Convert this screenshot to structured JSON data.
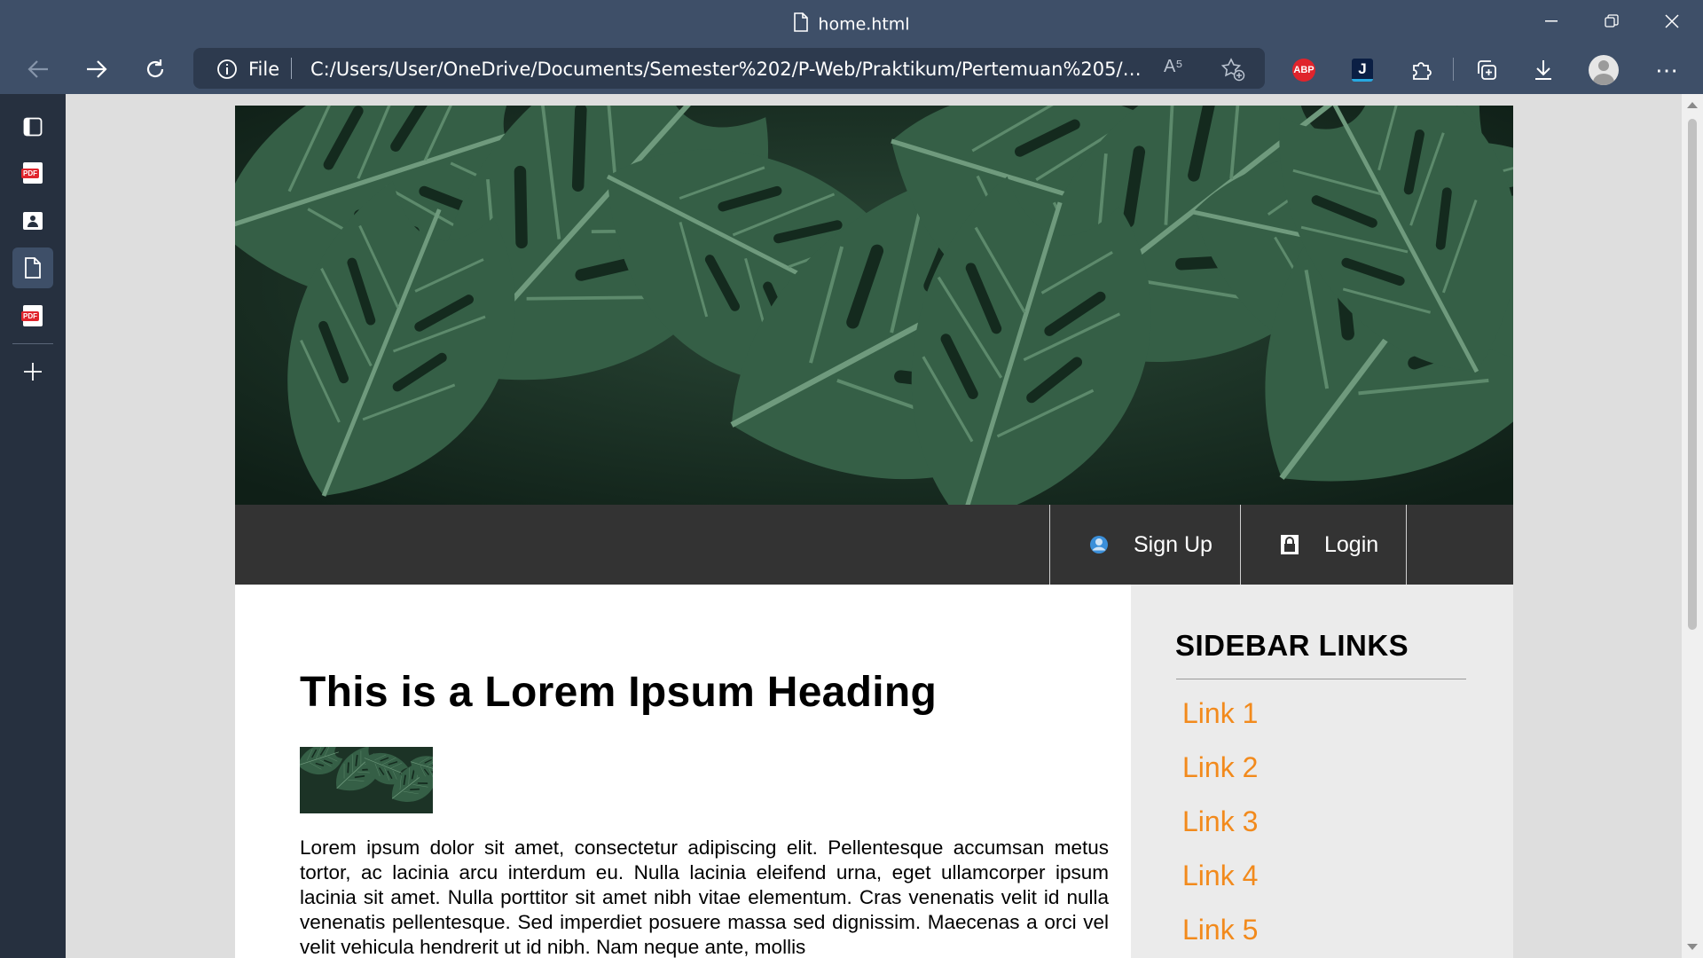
{
  "browser": {
    "tab_title": "home.html",
    "address": {
      "scheme_label": "File",
      "url": "C:/Users/User/OneDrive/Documents/Semester%202/P-Web/Praktikum/Pertemuan%205/Post/home.ht...",
      "read_aloud_label": "A⁵"
    },
    "extensions": {
      "adblock_label": "ABP",
      "j_label": "J"
    },
    "more_label": "⋯",
    "vertical_tabs": [
      "tab-actions",
      "pdf-document",
      "contact-card",
      "home.html",
      "pdf-document",
      "new-tab"
    ]
  },
  "page": {
    "nav": {
      "signup_label": "Sign Up",
      "login_label": "Login"
    },
    "main": {
      "heading": "This is a Lorem Ipsum Heading",
      "paragraph": "Lorem ipsum dolor sit amet, consectetur adipiscing elit. Pellentesque accumsan metus tortor, ac lacinia arcu interdum eu. Nulla lacinia eleifend urna, eget ullamcorper ipsum lacinia sit amet. Nulla porttitor sit amet nibh vitae elementum. Cras venenatis velit id nulla venenatis pellentesque. Sed imperdiet posuere massa sed dignissim. Maecenas a orci vel velit vehicula hendrerit ut id nibh. Nam neque ante, mollis"
    },
    "sidebar": {
      "title": "SIDEBAR LINKS",
      "links": [
        "Link 1",
        "Link 2",
        "Link 3",
        "Link 4",
        "Link 5"
      ]
    }
  },
  "colors": {
    "chrome": "#3e4f68",
    "nav_bar": "#333333",
    "sidebar_bg": "#ebebeb",
    "link_orange": "#f28a1c",
    "hero_leaf": "#2f5b42"
  }
}
